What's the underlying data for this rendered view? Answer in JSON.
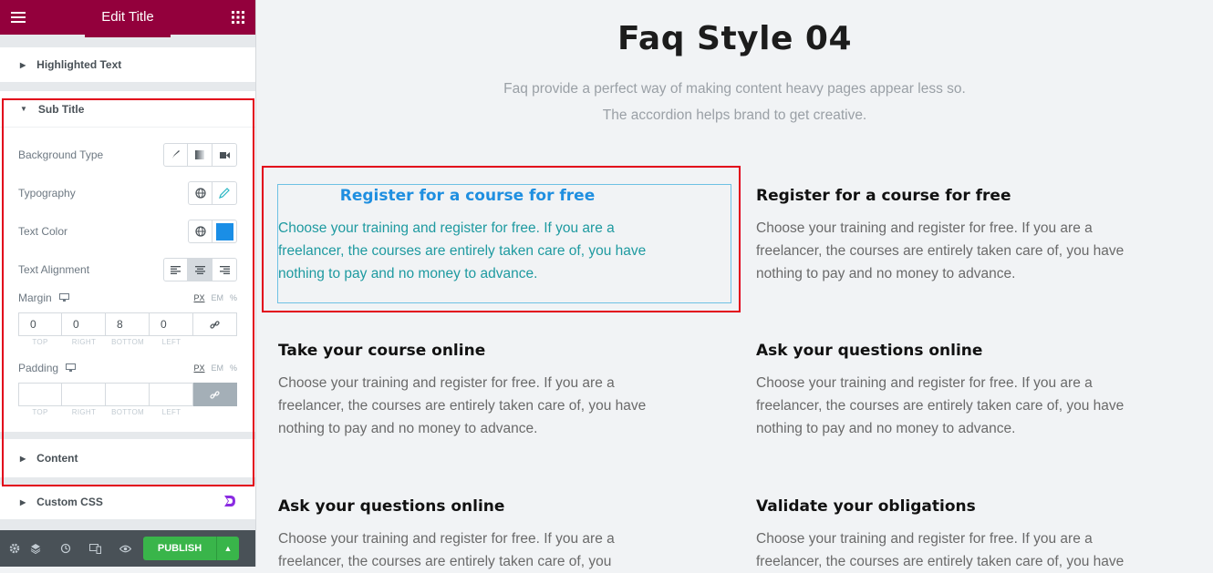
{
  "panel": {
    "title": "Edit Title",
    "sections": {
      "highlighted": "Highlighted Text",
      "subtitle": "Sub Title",
      "content": "Content",
      "custom_css": "Custom CSS"
    },
    "controls": {
      "background_type": "Background Type",
      "typography": "Typography",
      "text_color": "Text Color",
      "text_color_value": "#1a8ee6",
      "text_alignment": "Text Alignment",
      "margin": "Margin",
      "padding": "Padding"
    },
    "units": [
      "PX",
      "EM",
      "%"
    ],
    "margin_values": [
      "0",
      "0",
      "8",
      "0"
    ],
    "dim_labels": [
      "TOP",
      "RIGHT",
      "BOTTOM",
      "LEFT"
    ],
    "publish": "PUBLISH"
  },
  "page": {
    "heading": "Faq Style 04",
    "subtitle_line1": "Faq provide a perfect way of making content heavy pages appear less so.",
    "subtitle_line2": "The accordion helps brand to get creative.",
    "faqs": [
      {
        "q": "Register for a course for free",
        "a": "Choose your training and register for free. If you are a freelancer, the courses are entirely taken care of, you have nothing to pay and no money to advance."
      },
      {
        "q": "Register for a course for free",
        "a": "Choose your training and register for free. If you are a freelancer, the courses are entirely taken care of, you have nothing to pay and no money to advance."
      },
      {
        "q": "Take your course online",
        "a": "Choose your training and register for free. If you are a freelancer, the courses are entirely taken care of, you have nothing to pay and no money to advance."
      },
      {
        "q": "Ask your questions online",
        "a": "Choose your training and register for free. If you are a freelancer, the courses are entirely taken care of, you have nothing to pay and no money to advance."
      },
      {
        "q": "Ask your questions online",
        "a": "Choose your training and register for free. If you are a freelancer, the courses are entirely taken care of, you"
      },
      {
        "q": "Validate your obligations",
        "a": "Choose your training and register for free. If you are a freelancer, the courses are entirely taken care of, you have"
      }
    ]
  }
}
